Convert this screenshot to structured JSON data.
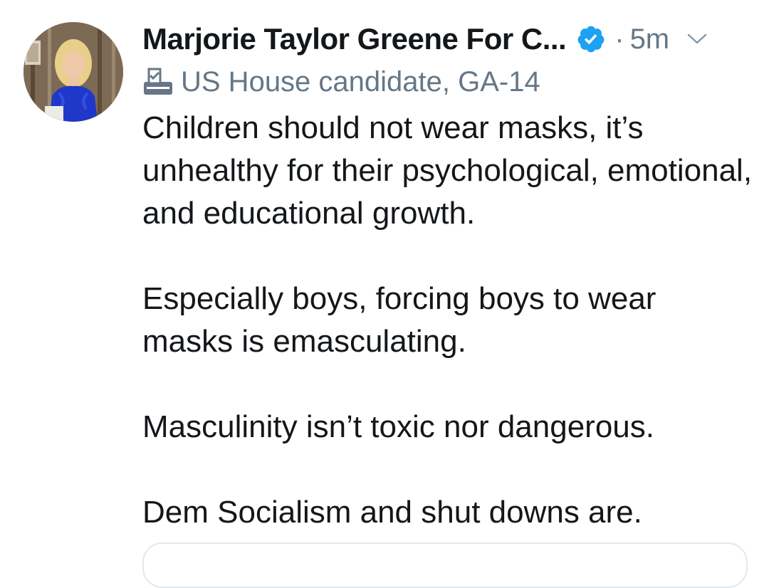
{
  "tweet": {
    "author_name": "Marjorie Taylor Greene For C...",
    "separator": "·",
    "timestamp": "5m",
    "label": "US House candidate, GA-14",
    "paragraphs": [
      "Children should not wear masks, it’s unhealthy for their psychological, emotional, and educational growth.",
      "Especially boys, forcing boys to wear masks is emasculating.",
      "Masculinity isn’t toxic nor dangerous.",
      "Dem Socialism and shut downs are."
    ]
  },
  "icons": {
    "verified": "verified-badge-icon",
    "label": "ballot-box-icon",
    "menu": "chevron-down-icon"
  },
  "colors": {
    "verified_blue": "#1da1f2",
    "secondary_text": "#657786",
    "primary_text": "#14171a"
  }
}
